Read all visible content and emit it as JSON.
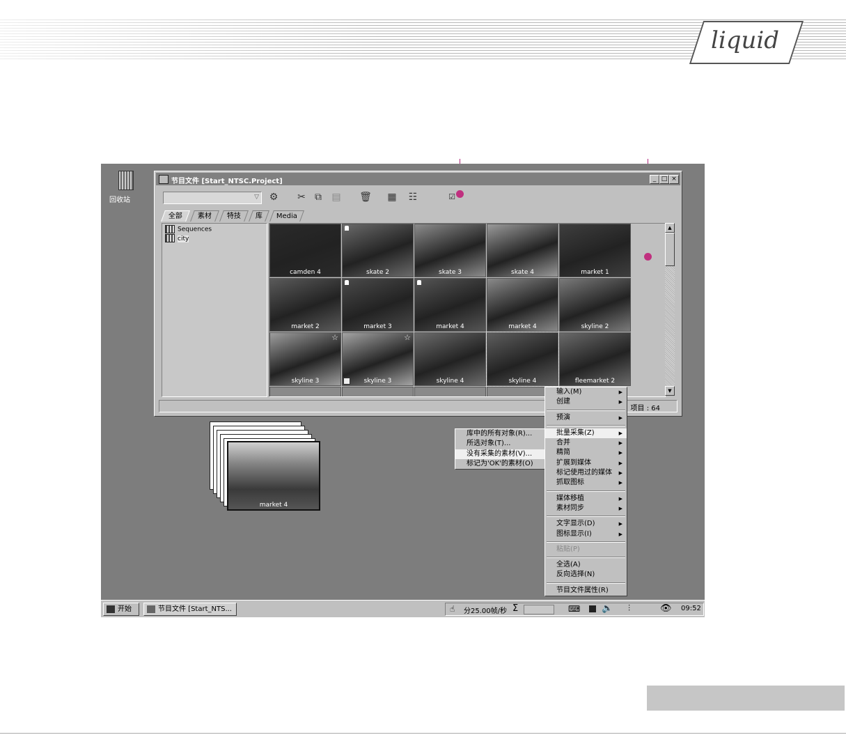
{
  "brand": {
    "logo_text": "liquid"
  },
  "desktop": {
    "recycle_bin_label": "回收站"
  },
  "window": {
    "title": "节目文件 [Start_NTSC.Project]",
    "controls": [
      "_",
      "□",
      "×"
    ],
    "tabs": [
      "全部",
      "素材",
      "特技",
      "库",
      "Media"
    ],
    "tree": [
      "Sequences",
      "city"
    ],
    "status_count": "项目 :   64"
  },
  "clips": [
    {
      "label": "camden 4",
      "tone": "#2a2a2a"
    },
    {
      "label": "skate 2",
      "tone": "#6a6a6a",
      "mark": true
    },
    {
      "label": "skate 3",
      "tone": "#8c8c8c"
    },
    {
      "label": "skate 4",
      "tone": "#9a9a9a"
    },
    {
      "label": "market 1",
      "tone": "#3e3e3e"
    },
    {
      "label": "market 2",
      "tone": "#5a5a5a"
    },
    {
      "label": "market 3",
      "tone": "#4a4a4a",
      "mark": true
    },
    {
      "label": "market 4",
      "tone": "#555555",
      "mark": true
    },
    {
      "label": "market 4",
      "tone": "#8a8a8a"
    },
    {
      "label": "skyline 2",
      "tone": "#7a7a7a"
    },
    {
      "label": "skyline 3",
      "tone": "#9e9e9e",
      "star": true
    },
    {
      "label": "skyline 3",
      "tone": "#a4a4a4",
      "star": true,
      "link": true
    },
    {
      "label": "skyline 4",
      "tone": "#6c6c6c"
    },
    {
      "label": "skyline 4",
      "tone": "#5e5e5e"
    },
    {
      "label": "fleemarket 2",
      "tone": "#6a6a6a"
    }
  ],
  "stacked_clip_label": "market 4",
  "context_menu": {
    "groups": [
      [
        {
          "label": "输入(M)",
          "sub": true
        },
        {
          "label": "创建",
          "sub": true
        }
      ],
      [
        {
          "label": "预演",
          "sub": true
        }
      ],
      [
        {
          "label": "批量采集(Z)",
          "sub": true,
          "hl": true
        },
        {
          "label": "合并",
          "sub": true
        },
        {
          "label": "精简",
          "sub": true
        },
        {
          "label": "扩展到媒体",
          "sub": true
        },
        {
          "label": "标记使用过的媒体",
          "sub": true
        },
        {
          "label": "抓取图标",
          "sub": true
        }
      ],
      [
        {
          "label": "媒体移植",
          "sub": true
        },
        {
          "label": "素材同步",
          "sub": true
        }
      ],
      [
        {
          "label": "文字显示(D)",
          "sub": true
        },
        {
          "label": "图标显示(I)",
          "sub": true
        }
      ],
      [
        {
          "label": "粘贴(P)",
          "dis": true
        }
      ],
      [
        {
          "label": "全选(A)"
        },
        {
          "label": "反向选择(N)"
        }
      ],
      [
        {
          "label": "节目文件属性(R)"
        }
      ]
    ]
  },
  "submenu": [
    {
      "label": "库中的所有对象(R)..."
    },
    {
      "label": "所选对象(T)..."
    },
    {
      "label": "没有采集的素材(V)...",
      "hl": true
    },
    {
      "label": "标记为'OK'的素材(O)"
    }
  ],
  "taskbar": {
    "start_label": "开始",
    "task_label": "节目文件 [Start_NTS...",
    "fps_label": "分25.00帧/秒",
    "sigma": "Σ",
    "clock": "09:52"
  }
}
